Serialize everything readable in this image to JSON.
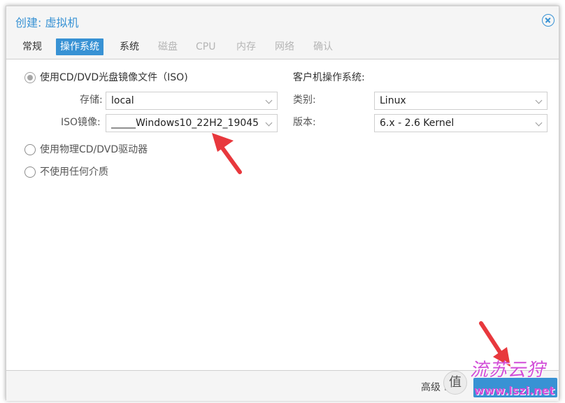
{
  "dialog": {
    "title": "创建: 虚拟机",
    "close_icon": "close-circle-icon"
  },
  "tabs": [
    {
      "label": "常规",
      "state": "normal"
    },
    {
      "label": "操作系统",
      "state": "active"
    },
    {
      "label": "系统",
      "state": "normal"
    },
    {
      "label": "磁盘",
      "state": "disabled"
    },
    {
      "label": "CPU",
      "state": "disabled"
    },
    {
      "label": "内存",
      "state": "disabled"
    },
    {
      "label": "网络",
      "state": "disabled"
    },
    {
      "label": "确认",
      "state": "disabled"
    }
  ],
  "media": {
    "options": [
      {
        "label": "使用CD/DVD光盘镜像文件（ISO)",
        "checked": true
      },
      {
        "label": "使用物理CD/DVD驱动器",
        "checked": false
      },
      {
        "label": "不使用任何介质",
        "checked": false
      }
    ],
    "storage_label": "存储:",
    "storage_value": "local",
    "iso_label": "ISO镜像:",
    "iso_value": "_____Windows10_22H2_19045."
  },
  "guest_os": {
    "section_title": "客户机操作系统:",
    "type_label": "类别:",
    "type_value": "Linux",
    "version_label": "版本:",
    "version_value": "6.x - 2.6 Kernel"
  },
  "footer": {
    "advanced_label": "高级"
  },
  "annotations": {
    "arrow_color": "#e8383d"
  },
  "watermark": {
    "badge_char": "值",
    "logo_text": "流苏云狩",
    "url": "www.lszi.net"
  },
  "colors": {
    "accent": "#3892d4",
    "disabled_text": "#b5b5b5"
  }
}
